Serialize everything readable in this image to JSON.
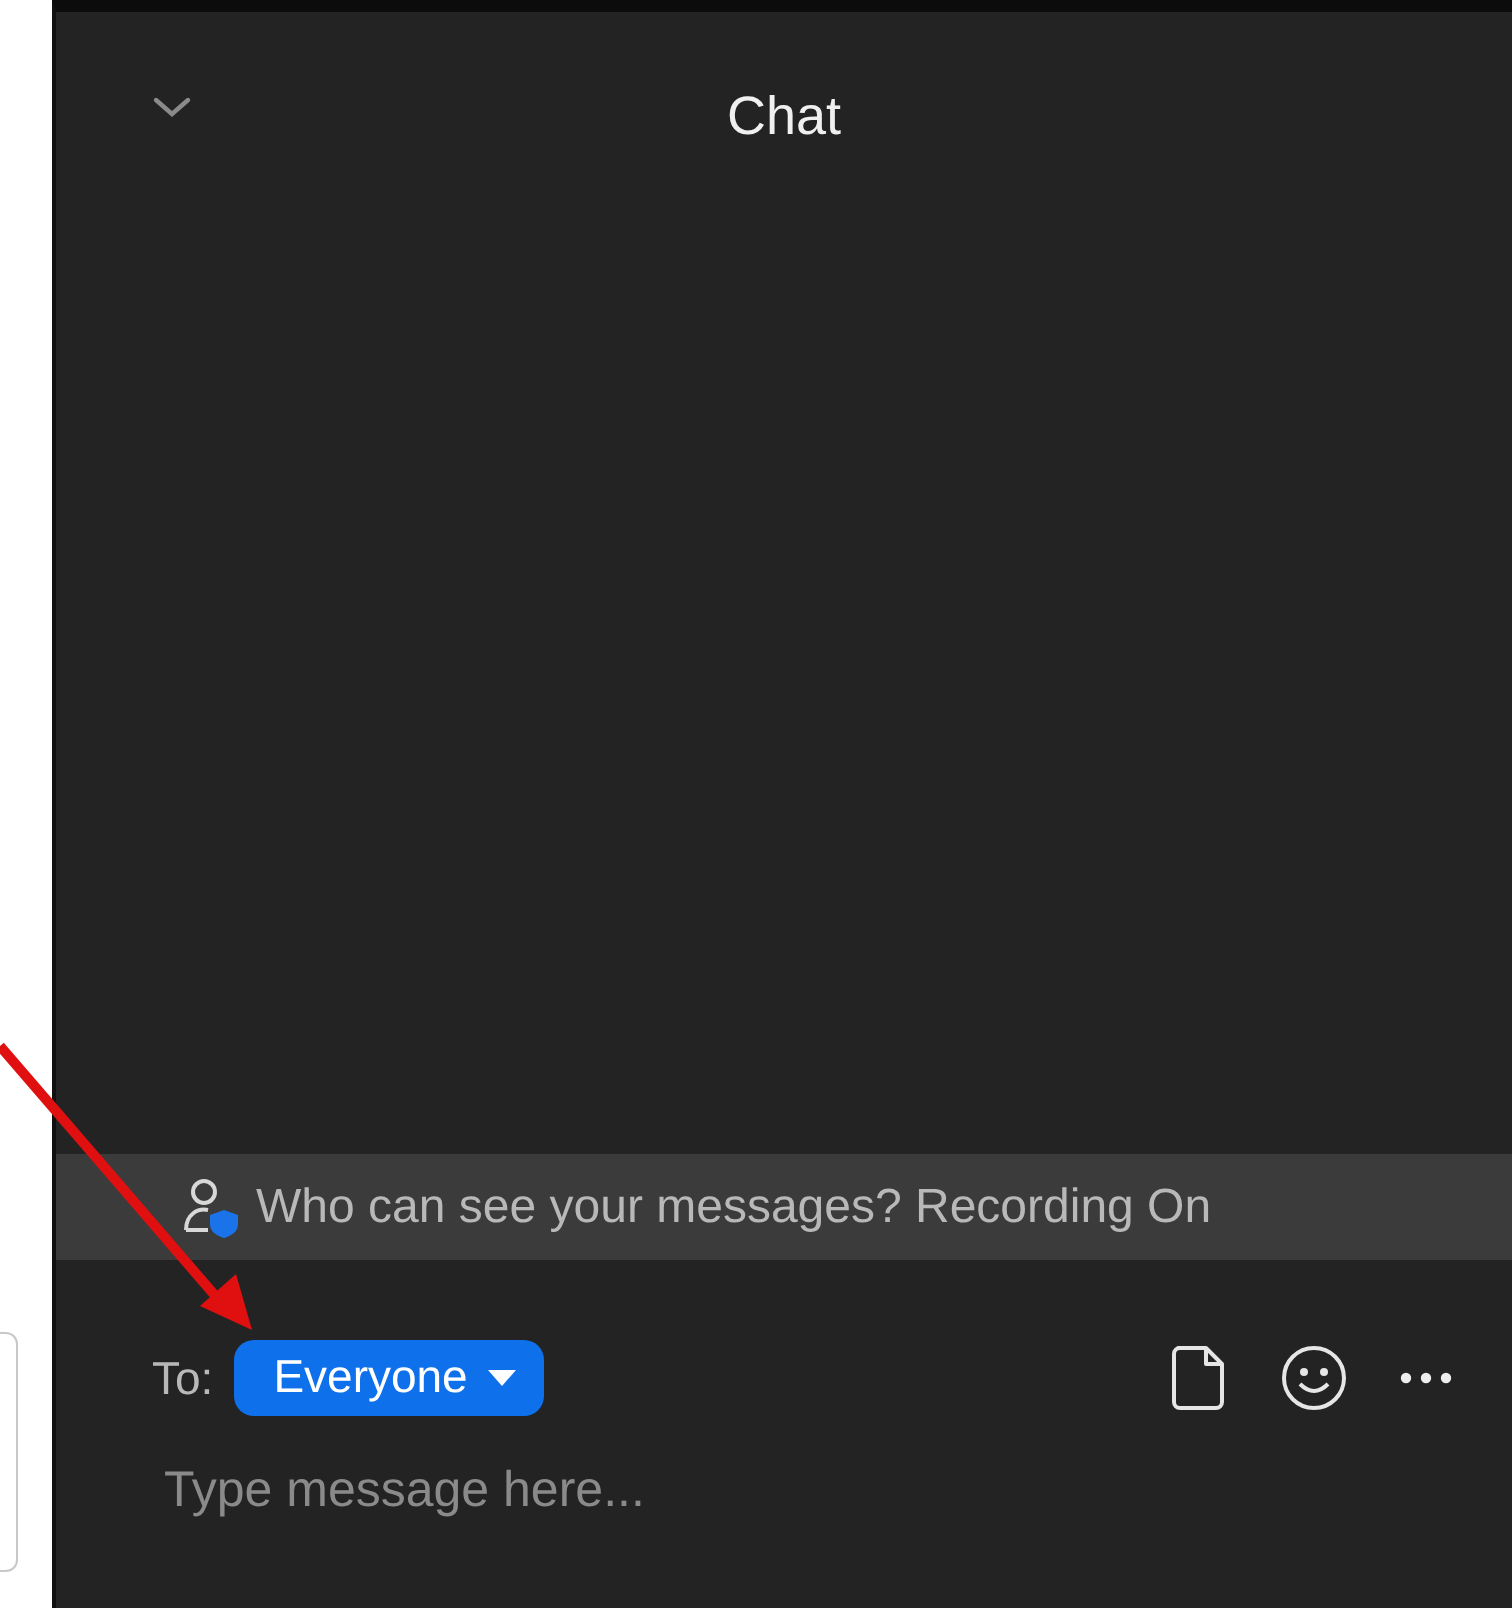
{
  "header": {
    "title": "Chat"
  },
  "notice": {
    "text": "Who can see your messages? Recording On"
  },
  "recipient": {
    "label": "To:",
    "value": "Everyone"
  },
  "composer": {
    "placeholder": "Type message here..."
  }
}
